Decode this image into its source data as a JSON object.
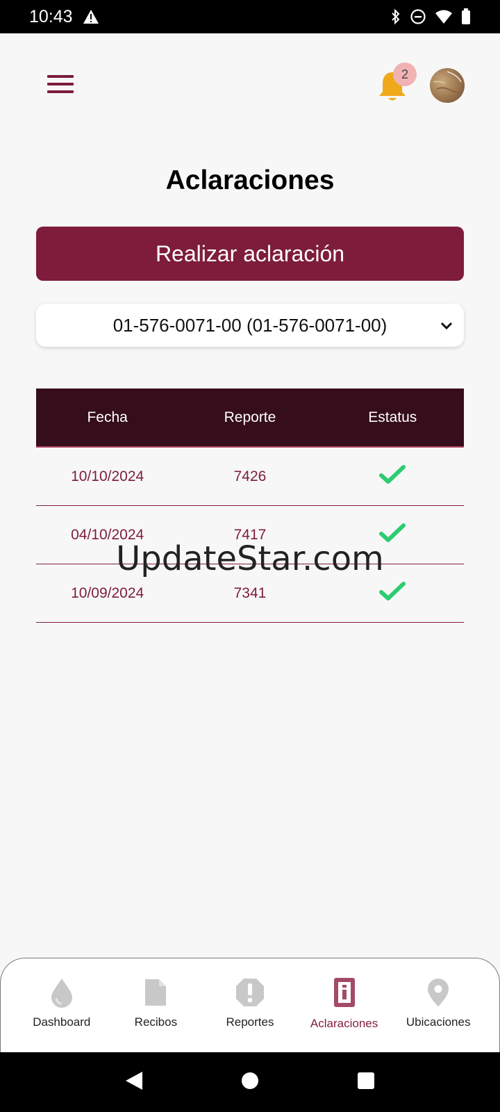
{
  "status_bar": {
    "time": "10:43"
  },
  "header": {
    "notification_count": "2"
  },
  "page": {
    "title": "Aclaraciones",
    "primary_button": "Realizar aclaración"
  },
  "account_select": {
    "value": "01-576-0071-00 (01-576-0071-00)"
  },
  "table": {
    "headers": [
      "Fecha",
      "Reporte",
      "Estatus"
    ],
    "rows": [
      {
        "fecha": "10/10/2024",
        "reporte": "7426",
        "estatus": "check-icon"
      },
      {
        "fecha": "04/10/2024",
        "reporte": "7417",
        "estatus": "check-icon"
      },
      {
        "fecha": "10/09/2024",
        "reporte": "7341",
        "estatus": "check-icon"
      }
    ]
  },
  "watermark": "UpdateStar.com",
  "bottom_nav": {
    "items": [
      {
        "label": "Dashboard",
        "icon": "drop-icon"
      },
      {
        "label": "Recibos",
        "icon": "document-icon"
      },
      {
        "label": "Reportes",
        "icon": "alert-icon"
      },
      {
        "label": "Aclaraciones",
        "icon": "info-icon",
        "active": true
      },
      {
        "label": "Ubicaciones",
        "icon": "location-pin-icon"
      }
    ]
  },
  "colors": {
    "brand": "#7e1d3b",
    "table_header": "#360d1b",
    "check": "#2ecc71",
    "bell": "#f0a91b"
  }
}
